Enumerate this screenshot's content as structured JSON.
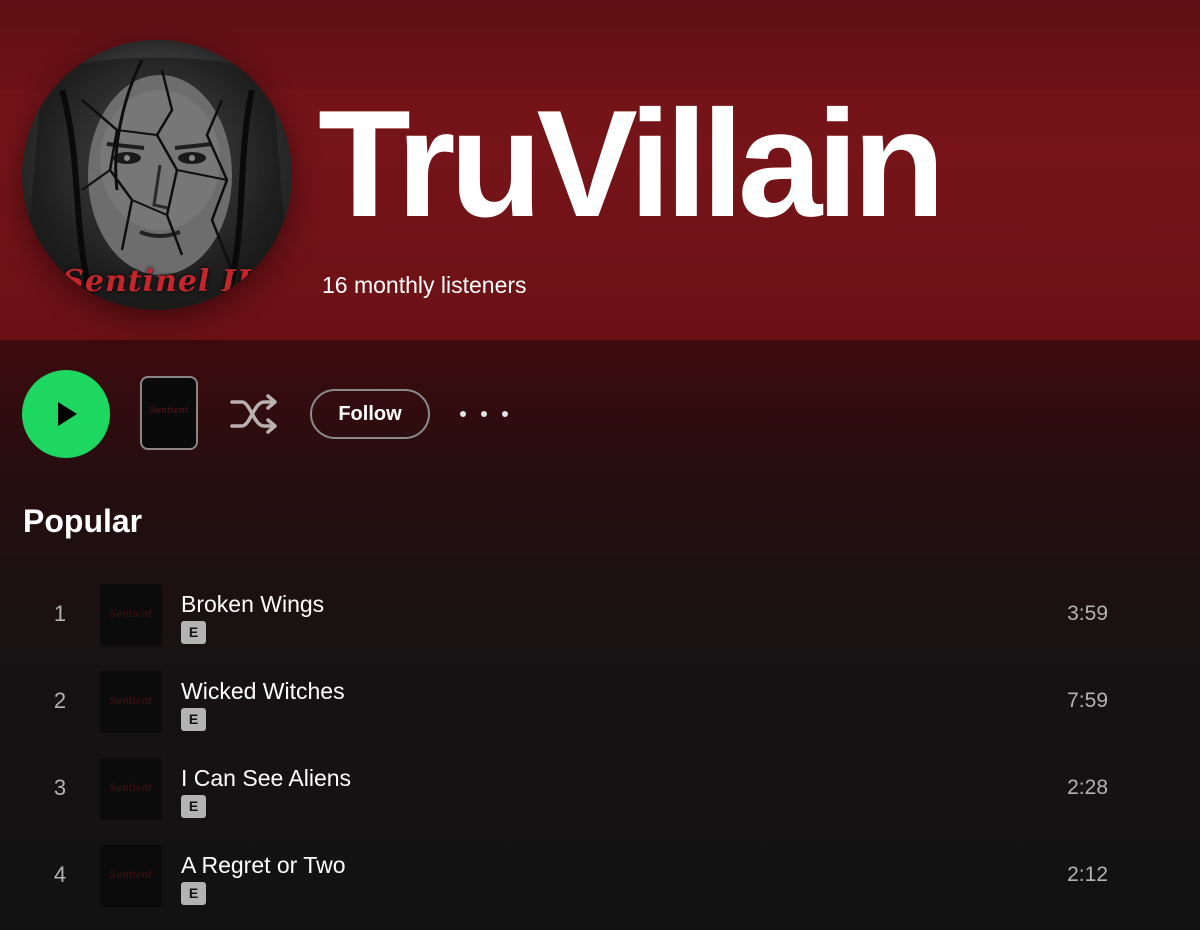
{
  "artist": {
    "name": "TruVillain",
    "monthly_listeners": "16 monthly listeners",
    "avatar_caption": "Sentinel II"
  },
  "controls": {
    "play_icon": "play-icon",
    "thumbnail_caption": "Sentient",
    "shuffle_icon": "shuffle-icon",
    "follow_label": "Follow",
    "more_icon": "more-options-icon"
  },
  "colors": {
    "header": "#761419",
    "play_button": "#1ed760",
    "background": "#121212"
  },
  "popular": {
    "title": "Popular",
    "tracks": [
      {
        "number": "1",
        "title": "Broken Wings",
        "explicit": "E",
        "duration": "3:59",
        "cover_caption": "Sentient"
      },
      {
        "number": "2",
        "title": "Wicked Witches",
        "explicit": "E",
        "duration": "7:59",
        "cover_caption": "Sentient"
      },
      {
        "number": "3",
        "title": "I Can See Aliens",
        "explicit": "E",
        "duration": "2:28",
        "cover_caption": "Sentient"
      },
      {
        "number": "4",
        "title": "A Regret or Two",
        "explicit": "E",
        "duration": "2:12",
        "cover_caption": "Sentient"
      }
    ]
  }
}
